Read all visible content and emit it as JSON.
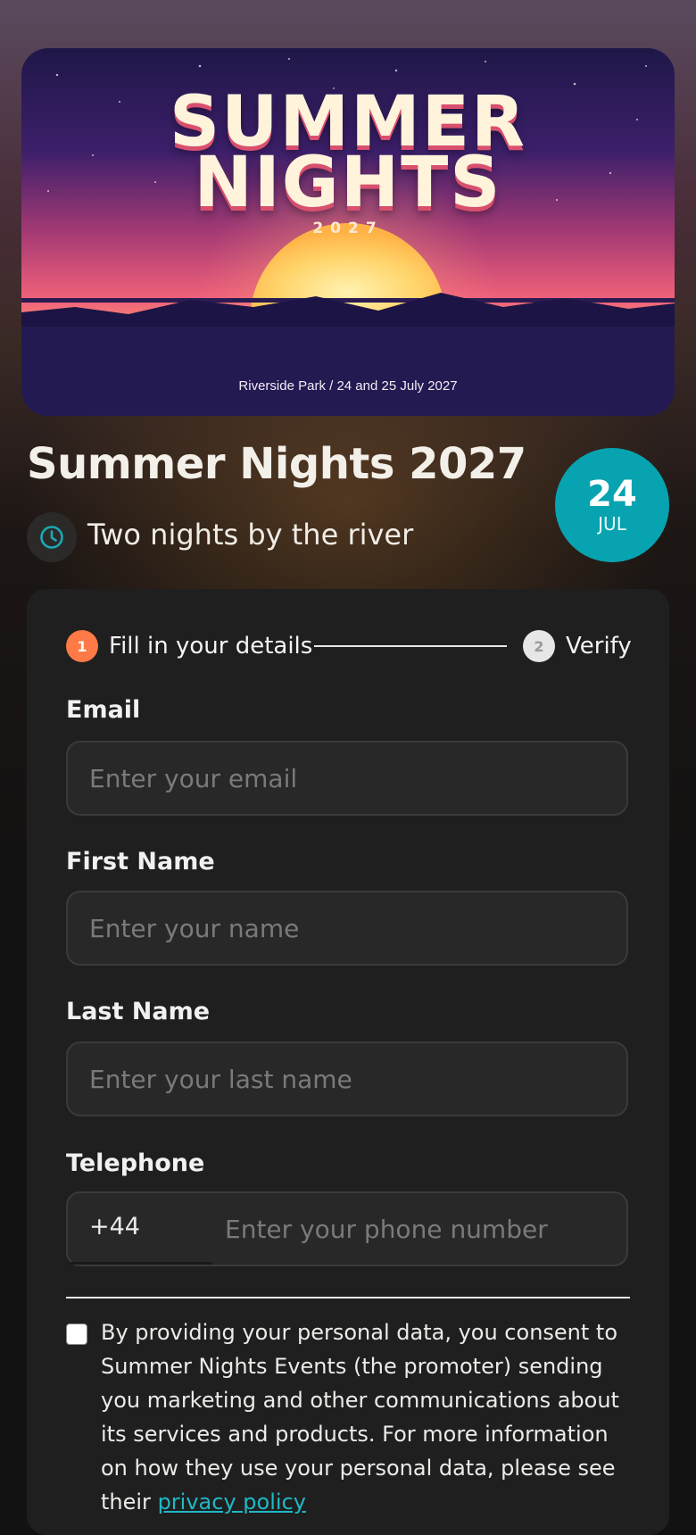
{
  "banner": {
    "title_line1": "SUMMER",
    "title_line2": "NIGHTS",
    "year": "2027",
    "venue": "Riverside Park / 24 and 25 July 2027"
  },
  "event": {
    "title": "Summer Nights 2027",
    "subtitle": "Two nights by the river",
    "date_day": "24",
    "date_month": "JUL",
    "icon": "clock-icon"
  },
  "steps": [
    {
      "number": "1",
      "label": "Fill in your details",
      "state": "active",
      "color": "#ff7a47"
    },
    {
      "number": "2",
      "label": "Verify",
      "state": "inactive",
      "color": "#e6e6e6"
    }
  ],
  "form": {
    "email": {
      "label": "Email",
      "placeholder": "Enter your email",
      "value": ""
    },
    "first_name": {
      "label": "First Name",
      "placeholder": "Enter your name",
      "value": ""
    },
    "last_name": {
      "label": "Last Name",
      "placeholder": "Enter your last name",
      "value": ""
    },
    "telephone": {
      "label": "Telephone",
      "country_code": "+44",
      "placeholder": "Enter your phone number",
      "value": ""
    }
  },
  "consent": {
    "checked": false,
    "text": "By providing your personal data, you consent to Summer Nights Events (the promoter) sending you marketing and other communications about its services and products. For more information on how they use your personal data, please see their ",
    "link_text": "privacy policy"
  },
  "colors": {
    "accent": "#08a3b0",
    "step_active": "#ff7a47",
    "link": "#1fb8c4",
    "card": "#1f1f1f"
  }
}
